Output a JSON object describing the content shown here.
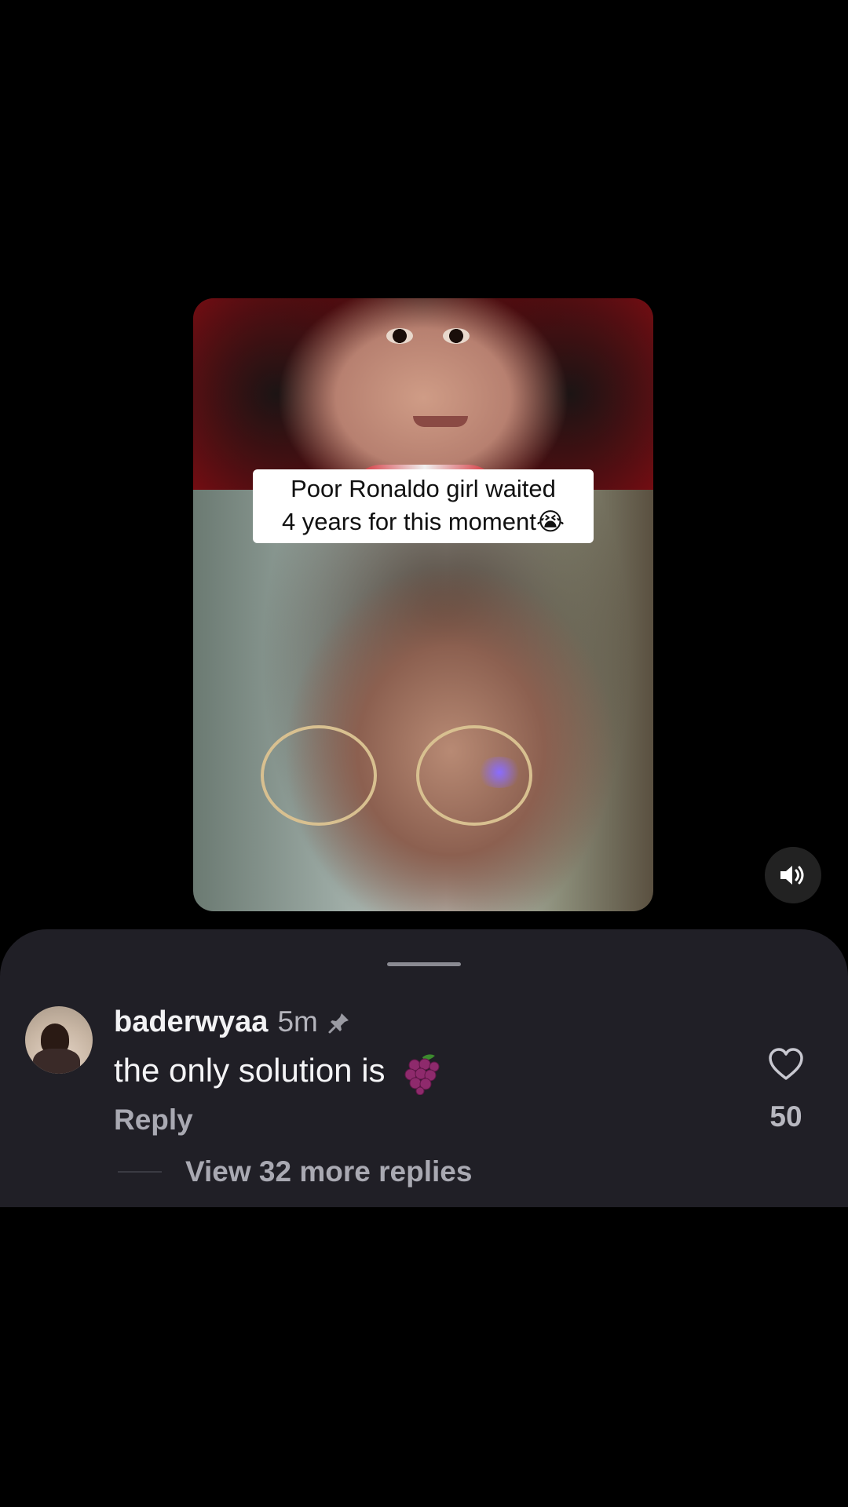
{
  "video": {
    "caption_line1": "Poor Ronaldo girl waited",
    "caption_line2": "4 years for this moment😭",
    "sound_icon": "speaker-on-icon"
  },
  "comment": {
    "username": "baderwyaa",
    "time": "5m",
    "pinned_icon": "pin-icon",
    "text": "the only solution is",
    "emoji_icon": "grapes-icon",
    "reply_label": "Reply",
    "like_icon": "heart-outline-icon",
    "like_count": "50",
    "view_replies_label": "View 32 more replies"
  },
  "colors": {
    "background": "#000000",
    "sheet": "#201f26",
    "primary_text": "#f2f2f4",
    "secondary_text": "#a9a9b2"
  }
}
